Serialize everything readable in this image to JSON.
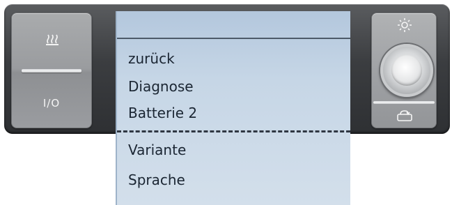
{
  "left_panel": {
    "heat_icon": "seat-heating-icon",
    "power_label": "I/O"
  },
  "menu": {
    "items": [
      {
        "label": "zurück"
      },
      {
        "label": "Diagnose"
      },
      {
        "label": "Batterie 2"
      },
      {
        "label": "Variante"
      },
      {
        "label": "Sprache"
      }
    ]
  },
  "right_panel": {
    "top_icon": "sun-icon",
    "bottom_icon": "recirculation-icon"
  },
  "colors": {
    "device_body": "#3b3d40",
    "button_face": "#9a9c9f",
    "menu_background": "#c6d6e6",
    "menu_text": "#1b2633"
  }
}
